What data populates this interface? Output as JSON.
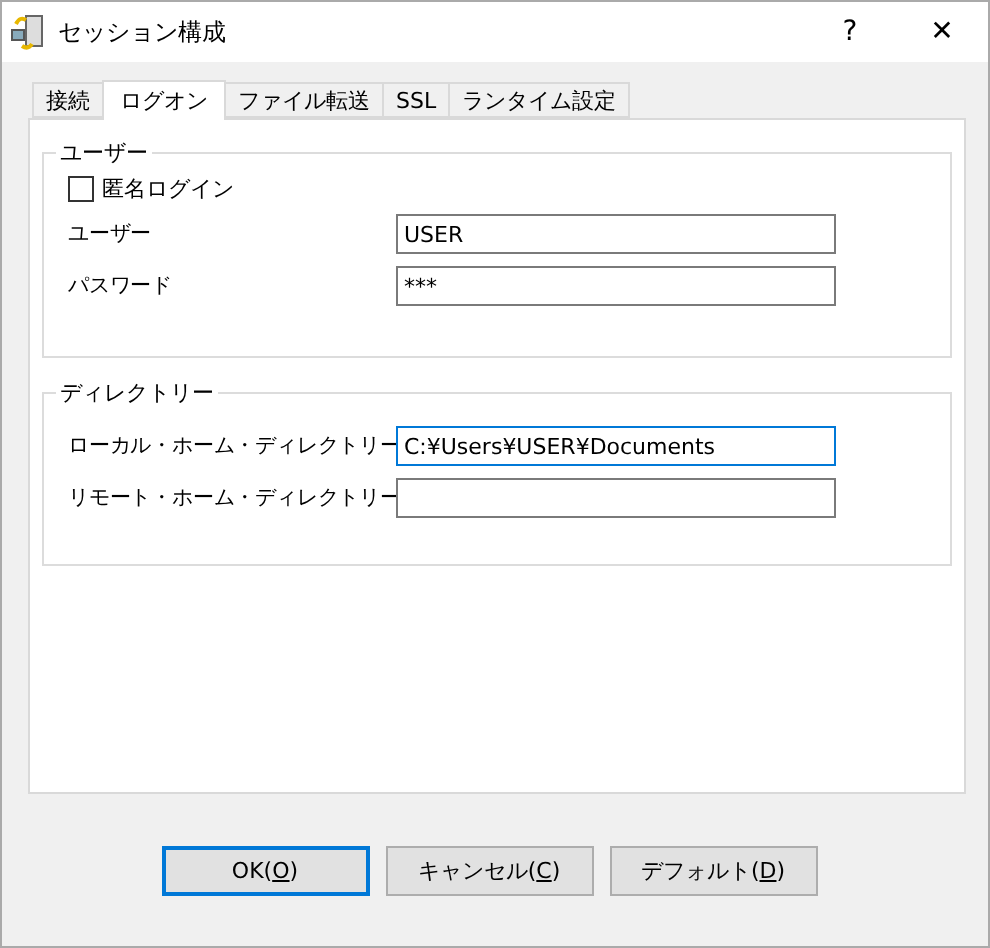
{
  "window": {
    "title": "セッション構成",
    "help": "?",
    "close": "✕"
  },
  "tabs": [
    {
      "label": "接続",
      "selected": false
    },
    {
      "label": "ログオン",
      "selected": true
    },
    {
      "label": "ファイル転送",
      "selected": false
    },
    {
      "label": "SSL",
      "selected": false
    },
    {
      "label": "ランタイム設定",
      "selected": false
    }
  ],
  "user_group": {
    "title": "ユーザー",
    "anonymous": {
      "label": "匿名ログイン",
      "checked": false
    },
    "fields": [
      {
        "label": "ユーザー",
        "value": "USER",
        "focused": false
      },
      {
        "label": "パスワード",
        "value": "***",
        "focused": false
      }
    ]
  },
  "directory_group": {
    "title": "ディレクトリー",
    "fields": [
      {
        "label": "ローカル・ホーム・ディレクトリー",
        "value": "C:¥Users¥USER¥Documents",
        "focused": true
      },
      {
        "label": "リモート・ホーム・ディレクトリー",
        "focused": false
      }
    ]
  },
  "buttons": [
    {
      "before": "OK(",
      "mnemonic": "O",
      "after": ")",
      "default": true
    },
    {
      "before": "キャンセル(",
      "mnemonic": "C",
      "after": ")",
      "default": false
    },
    {
      "before": "デフォルト(",
      "mnemonic": "D",
      "after": ")",
      "default": false
    }
  ]
}
